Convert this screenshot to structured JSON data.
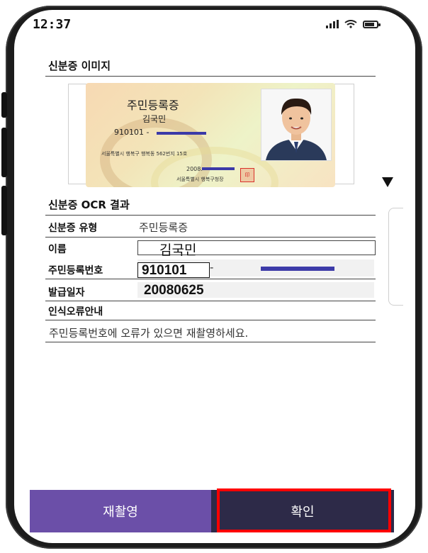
{
  "status": {
    "time": "12:37"
  },
  "id_image": {
    "section_title": "신분증 이미지",
    "card": {
      "title": "주민등록증",
      "name": "김국민",
      "rrn_prefix": "910101 -",
      "address": "서울특별시 행복구 행복동 562번지 15호",
      "issue_date_prefix": "2008.",
      "issuer": "서울특별시  행복구청장",
      "seal_text": "印"
    }
  },
  "ocr": {
    "section_title": "신분증 OCR 결과",
    "rows": [
      {
        "label": "신분증 유형",
        "value": "주민등록증"
      },
      {
        "label": "이름",
        "value": "김국민"
      },
      {
        "label": "주민등록번호",
        "value": "910101",
        "suffix": "-"
      },
      {
        "label": "발급일자",
        "value": "20080625"
      }
    ],
    "error_section_title": "인식오류안내",
    "notice": "주민등록번호에 오류가 있으면 재촬영하세요."
  },
  "buttons": {
    "retake": "재촬영",
    "confirm": "확인"
  },
  "colors": {
    "retake_bg": "#6b4fa8",
    "confirm_bg": "#2d2a48",
    "highlight": "#ff0000",
    "redaction": "#3c3aa8"
  }
}
